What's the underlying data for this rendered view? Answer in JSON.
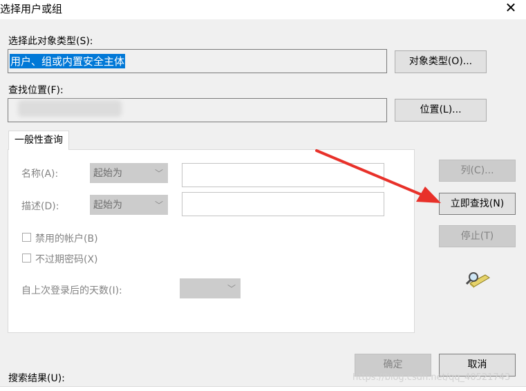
{
  "window": {
    "title": "选择用户或组",
    "close_glyph": "✕"
  },
  "object_type": {
    "label": "选择此对象类型(S):",
    "value": "用户、组或内置安全主体",
    "button": "对象类型(O)..."
  },
  "location": {
    "label": "查找位置(F):",
    "button": "位置(L)..."
  },
  "tab": {
    "label": "一般性查询"
  },
  "query": {
    "name_label": "名称(A):",
    "name_mode": "起始为",
    "desc_label": "描述(D):",
    "desc_mode": "起始为",
    "disabled_accounts": "禁用的帐户(B)",
    "no_expire_pwd": "不过期密码(X)",
    "days_label": "自上次登录后的天数(I):"
  },
  "side_buttons": {
    "columns": "列(C)...",
    "find_now": "立即查找(N)",
    "stop": "停止(T)"
  },
  "footer": {
    "ok": "确定",
    "cancel": "取消",
    "results_label": "搜索结果(U):",
    "watermark": "https://blog.csdn.net/qq_40521743"
  },
  "colors": {
    "selection": "#0078d7",
    "arrow": "#e8312a"
  }
}
